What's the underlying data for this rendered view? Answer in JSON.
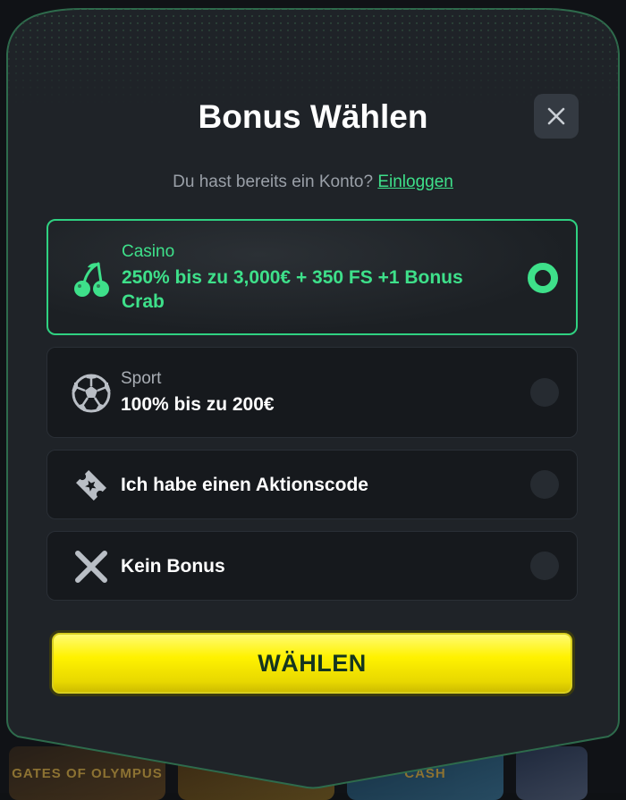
{
  "background": {
    "thumbnails": [
      "GATES OF OLYMPUS",
      "",
      "CASH",
      ""
    ]
  },
  "modal": {
    "title": "Bonus Wählen",
    "close_icon": "close-icon",
    "subtitle_text": "Du hast bereits ein Konto?",
    "login_link": "Einloggen",
    "accent_color": "#3ee08a",
    "options": [
      {
        "label": "Casino",
        "value": "250% bis zu 3,000€ + 350 FS +1 Bonus Crab",
        "icon": "cherry-icon",
        "selected": true
      },
      {
        "label": "Sport",
        "value": "100% bis zu 200€",
        "icon": "soccer-ball-icon",
        "selected": false
      },
      {
        "label": "",
        "value": "Ich habe einen Aktionscode",
        "icon": "ticket-icon",
        "selected": false
      },
      {
        "label": "",
        "value": "Kein Bonus",
        "icon": "x-icon",
        "selected": false
      }
    ],
    "submit_label": "WÄHLEN",
    "submit_color": "#fff200"
  }
}
